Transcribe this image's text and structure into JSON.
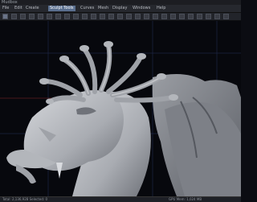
{
  "app": {
    "title": "Mudbox"
  },
  "menu": {
    "items": [
      {
        "label": "File"
      },
      {
        "label": "Edit"
      },
      {
        "label": "Create"
      },
      {
        "label": "Curves"
      },
      {
        "label": "Mesh"
      },
      {
        "label": "Display"
      },
      {
        "label": "Windows"
      },
      {
        "label": "Help"
      }
    ],
    "active_label": "Sculpt Tools"
  },
  "toolbar": {
    "icons": [
      "sculpt-icon",
      "smooth-icon",
      "grab-icon",
      "pinch-icon",
      "flatten-icon",
      "foamy-icon",
      "spray-icon",
      "repeat-icon",
      "imprint-icon",
      "wax-icon",
      "scrape-icon",
      "fill-icon",
      "knife-icon",
      "smear-icon",
      "bulge-icon",
      "amplify-icon",
      "freeze-icon",
      "mask-icon",
      "erase-icon",
      "move-icon",
      "rotate-icon",
      "scale-icon",
      "camera-icon",
      "light-icon",
      "grid-icon",
      "render-icon"
    ]
  },
  "viewport": {
    "subject": "Sculpted dragon head with snake-like horns and wings",
    "background": "#07080d",
    "model_color": "#b9bcc0",
    "grid_color": "#2a3a6a",
    "accent_color": "#c23b3b"
  },
  "status": {
    "left": "Total: 2,136,928 Selected: 0",
    "right": "GPU Mem: 1,024 MB"
  }
}
